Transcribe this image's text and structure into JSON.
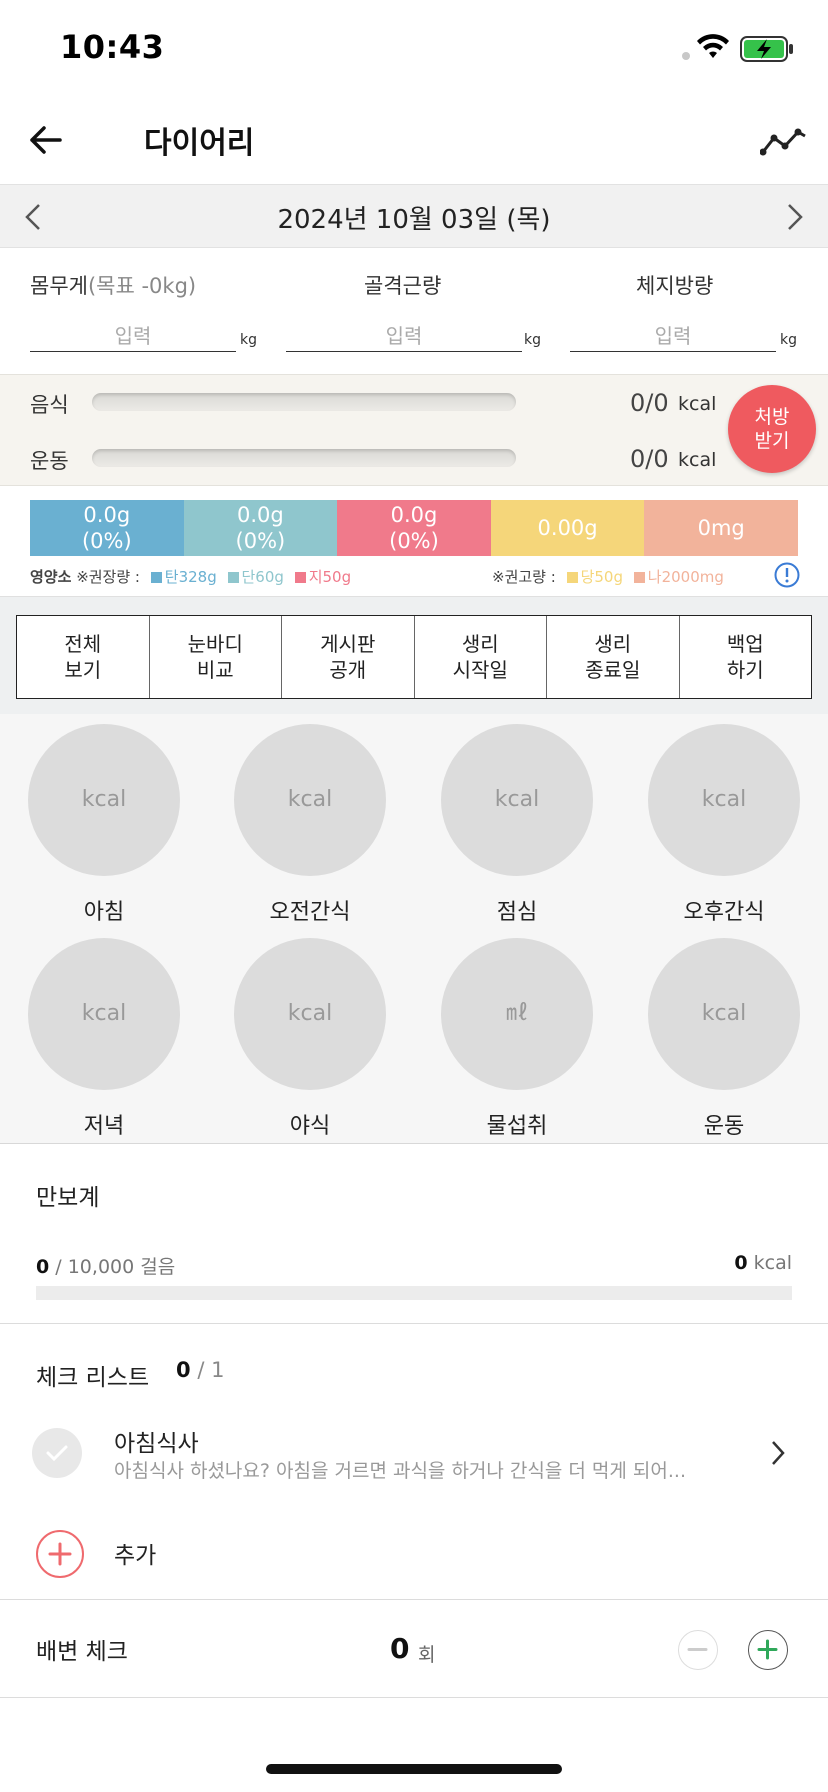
{
  "status_bar": {
    "time": "10:43"
  },
  "header": {
    "title": "다이어리",
    "back_icon": "arrow-left-icon",
    "trend_icon": "trend-line-icon"
  },
  "date_bar": {
    "date": "2024년 10월 03일 (목)"
  },
  "metrics": {
    "weight_label": "몸무게",
    "weight_goal": "(목표 -0kg)",
    "muscle_label": "골격근량",
    "fat_label": "체지방량",
    "placeholder": "입력",
    "unit": "kg"
  },
  "calories": {
    "food_label": "음식",
    "food_value": "0/0",
    "exercise_label": "운동",
    "exercise_value": "0/0",
    "unit": "kcal",
    "rx_button_line1": "처방",
    "rx_button_line2": "받기"
  },
  "nutrients": {
    "segments": [
      {
        "line1": "0.0g",
        "line2": "(0%)",
        "color": "#6ab0d1"
      },
      {
        "line1": "0.0g",
        "line2": "(0%)",
        "color": "#8fc6cd"
      },
      {
        "line1": "0.0g",
        "line2": "(0%)",
        "color": "#f07a8b"
      },
      {
        "line1": "0.00g",
        "line2": "",
        "color": "#f5d67a"
      },
      {
        "line1": "0mg",
        "line2": "",
        "color": "#f2b39b"
      }
    ],
    "legend_left_title": "영양소",
    "legend_left_note": "※권장량 :",
    "carb": "탄328g",
    "protein": "단60g",
    "fat": "지50g",
    "legend_right_note": "※권고량 :",
    "sugar": "당50g",
    "sodium": "나2000mg"
  },
  "actions": [
    {
      "line1": "전체",
      "line2": "보기"
    },
    {
      "line1": "눈바디",
      "line2": "비교"
    },
    {
      "line1": "게시판",
      "line2": "공개"
    },
    {
      "line1": "생리",
      "line2": "시작일"
    },
    {
      "line1": "생리",
      "line2": "종료일"
    },
    {
      "line1": "백업",
      "line2": "하기"
    }
  ],
  "meals": [
    {
      "unit": "kcal",
      "label": "아침"
    },
    {
      "unit": "kcal",
      "label": "오전간식"
    },
    {
      "unit": "kcal",
      "label": "점심"
    },
    {
      "unit": "kcal",
      "label": "오후간식"
    },
    {
      "unit": "kcal",
      "label": "저녁"
    },
    {
      "unit": "kcal",
      "label": "야식"
    },
    {
      "unit": "㎖",
      "label": "물섭취"
    },
    {
      "unit": "kcal",
      "label": "운동"
    }
  ],
  "pedometer": {
    "title": "만보계",
    "steps": "0",
    "goal": "/ 10,000 걸음",
    "kcal": "0",
    "kcal_unit": "kcal"
  },
  "checklist": {
    "title": "체크 리스트",
    "done": "0",
    "total": "/ 1",
    "item_title": "아침식사",
    "item_desc": "아침식사 하셨나요? 아침을 거르면 과식을 하거나 간식을 더 먹게 되어...",
    "add_label": "추가"
  },
  "bowel": {
    "title": "배변 체크",
    "count": "0",
    "unit": "회"
  }
}
